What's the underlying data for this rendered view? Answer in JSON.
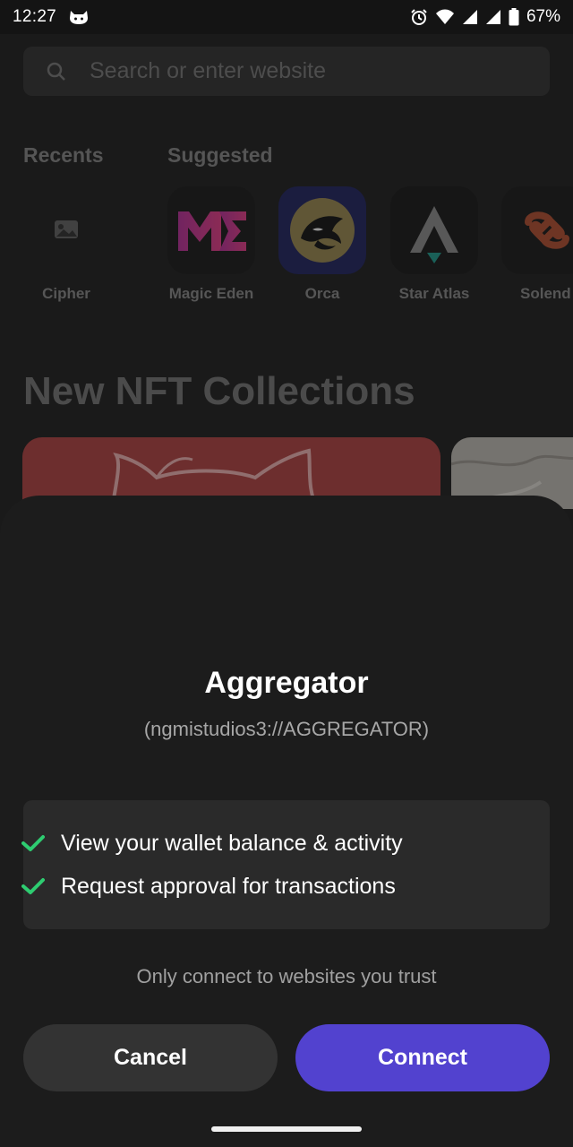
{
  "status_bar": {
    "time": "12:27",
    "battery": "67%"
  },
  "search": {
    "placeholder": "Search or enter website"
  },
  "sections": {
    "recents": "Recents",
    "suggested": "Suggested"
  },
  "recents": [
    {
      "name": "Cipher",
      "icon": "image-placeholder-icon"
    }
  ],
  "suggested": [
    {
      "name": "Magic Eden",
      "icon": "magic-eden-logo"
    },
    {
      "name": "Orca",
      "icon": "orca-logo"
    },
    {
      "name": "Star Atlas",
      "icon": "star-atlas-logo"
    },
    {
      "name": "Solend",
      "icon": "solend-logo"
    }
  ],
  "nft": {
    "heading": "New NFT Collections"
  },
  "sheet": {
    "title": "Aggregator",
    "url": "(ngmistudios3://AGGREGATOR)",
    "permissions": [
      "View your wallet balance & activity",
      "Request approval for transactions"
    ],
    "trust_note": "Only connect to websites you trust",
    "cancel_label": "Cancel",
    "connect_label": "Connect"
  },
  "colors": {
    "accent": "#5242cf",
    "check": "#2ecc71",
    "sheet_bg": "#1c1c1c"
  }
}
